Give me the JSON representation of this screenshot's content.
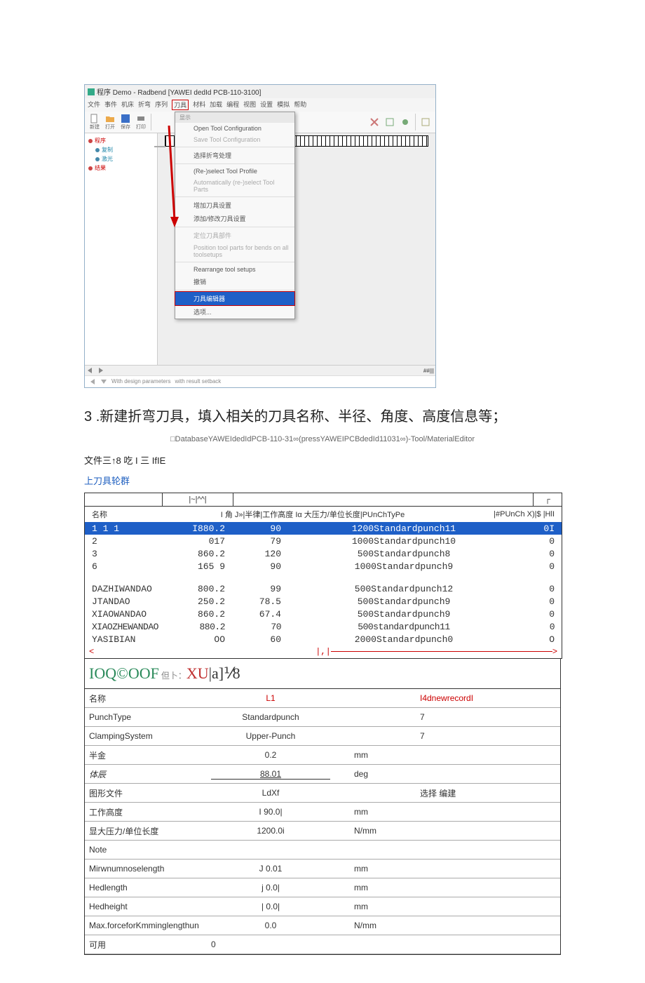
{
  "screenshot": {
    "title": "程序 Demo - Radbend [YAWEI dedId PCB-110-3100]",
    "menu": [
      "文件",
      "事件",
      "机床",
      "折弯",
      "序列",
      "刀具",
      "材料",
      "加载",
      "编程",
      "视图",
      "设置",
      "模拟",
      "帮助"
    ],
    "toolbar": [
      {
        "icon": "new",
        "label": "新建"
      },
      {
        "icon": "open",
        "label": "打开"
      },
      {
        "icon": "save",
        "label": "保存"
      },
      {
        "icon": "print",
        "label": "打印"
      }
    ],
    "toolbar_right": [
      {
        "icon": "scissors",
        "label": ""
      },
      {
        "icon": "box",
        "label": ""
      },
      {
        "icon": "gear",
        "label": ""
      },
      {
        "icon": "grid",
        "label": ""
      }
    ],
    "tree": [
      {
        "label": "程序",
        "color": "#c00"
      },
      {
        "label": "复制",
        "color": "#28a"
      },
      {
        "label": "激光",
        "color": "#28a"
      },
      {
        "label": "结果",
        "color": "#c00"
      }
    ],
    "dropdown_header": "显示",
    "dropdown": [
      {
        "label": "Open Tool Configuration",
        "type": "item"
      },
      {
        "label": "Save Tool Configuration",
        "type": "disabled"
      },
      {
        "type": "hr"
      },
      {
        "label": "选择折弯处理",
        "type": "item"
      },
      {
        "type": "hr"
      },
      {
        "label": "(Re-)select Tool Profile",
        "type": "item"
      },
      {
        "label": "Automatically (re-)select Tool Parts",
        "type": "disabled"
      },
      {
        "type": "hr"
      },
      {
        "label": "增加刀具设置",
        "type": "item"
      },
      {
        "label": "添加/修改刀具设置",
        "type": "item"
      },
      {
        "type": "hr"
      },
      {
        "label": "定位刀具部件",
        "type": "disabled"
      },
      {
        "label": "Position tool parts for bends on all toolsetups",
        "type": "disabled"
      },
      {
        "type": "hr"
      },
      {
        "label": "Rearrange tool setups",
        "type": "item"
      },
      {
        "label": "撤销",
        "type": "item"
      },
      {
        "type": "hr"
      },
      {
        "label": "刀具编辑器",
        "type": "selected"
      },
      {
        "label": "选项...",
        "type": "item"
      }
    ],
    "status_left": "With design parameters",
    "status_right": "with result setback"
  },
  "step": {
    "num": "3",
    "text": ".新建折弯刀具，填入相关的刀具名称、半径、角度、高度信息等；"
  },
  "subheader": "□DatabaseYAWEIdedIdPCB-110-31∞(pressYAWEIPCBdedId11031∞)-Tool/MaterialEditor",
  "line2": "文件三↑8 吃 I 三 IfIE",
  "link_label": "上刀具轮群",
  "table": {
    "header_groups": [
      "|~|^^|",
      "┌"
    ],
    "header_line": {
      "name": "名称",
      "mid": "I 角 J»|半律|工作高度 Iα 大压力/单位长度|PUnChTyPe",
      "end": "|#PUnCh X)|$ |HlI"
    },
    "rows": [
      {
        "sel": true,
        "name": "1 1 1",
        "r": "I880.2",
        "ang": "90",
        "desc": "1200Standardpunch11",
        "e": "0I"
      },
      {
        "name": "2",
        "r": "017",
        "ang": "79",
        "desc": "1000Standardpunch10",
        "e": "0"
      },
      {
        "name": "3",
        "r": "860.2",
        "ang": "120",
        "desc": "500Standardpunch8",
        "e": "0"
      },
      {
        "name": "6",
        "r": "165   9",
        "ang": "90",
        "desc": "1000Standardpunch9",
        "e": "0"
      },
      {
        "gap": true
      },
      {
        "name": "DAZHIWANDAO",
        "r": "800.2",
        "ang": "99",
        "desc": "500Standardpunch12",
        "e": "0"
      },
      {
        "name": "JTANDAO",
        "r": "250.2",
        "ang": "78.5",
        "desc": "500Standardpunch9",
        "e": "0"
      },
      {
        "name": "XIAOWANDAO",
        "r": "860.2",
        "ang": "67.4",
        "desc": "500Standardpunch9",
        "e": "0"
      },
      {
        "name": "XIAOZHEWANDAO",
        "r": "880.2",
        "ang": "70",
        "desc": "500standardpunch11",
        "e": "0",
        "tight": true
      },
      {
        "name": "YASIBIAN",
        "r": "OO",
        "ang": "60",
        "desc": "2000Standardpunch0",
        "e": "O"
      }
    ],
    "scroll_mid": "|,|"
  },
  "bigtext": {
    "a": "IOQ©OOF",
    "mid": " 但卜：",
    "b": "XU",
    "c": "|a]⅟8"
  },
  "form": [
    {
      "lbl": "名称",
      "val": "L1",
      "vstyle": "red",
      "unit": "",
      "extra": "I4dnewrecordI",
      "extrastyle": "red"
    },
    {
      "lbl": "PunchType",
      "val": "Standardpunch",
      "unit": "",
      "extra": "7"
    },
    {
      "lbl": "ClampingSystem",
      "val": "Upper-Punch",
      "unit": "",
      "extra": "7"
    },
    {
      "lbl": "半金",
      "val": "0.2",
      "unit": "mm"
    },
    {
      "lbl": "体辰",
      "val": "88.01",
      "vstyle": "u",
      "unit": "deg",
      "lblstyle": "italic"
    },
    {
      "lbl": "图形文件",
      "val": "LdXf",
      "unit": "",
      "extra": "选择          编建"
    },
    {
      "lbl": "工作高度",
      "val": "I       90.0|",
      "unit": "mm"
    },
    {
      "lbl": "显大压力/单位长度",
      "val": "1200.0i",
      "unit": "N/mm"
    },
    {
      "lbl": "Note",
      "val": "",
      "unit": ""
    },
    {
      "lbl": "Mirwnumnoselength",
      "val": "J          0.01",
      "unit": "mm"
    },
    {
      "lbl": "Hedlength",
      "val": "j          0.0|",
      "unit": "mm"
    },
    {
      "lbl": "Hedheight",
      "val": "|          0.0|",
      "unit": "mm"
    },
    {
      "lbl": "Max.forceforKmminglengthun",
      "val": "0.0",
      "unit": "N/mm"
    },
    {
      "lbl": "可用",
      "val": "0",
      "valign": "left",
      "unit": ""
    }
  ]
}
